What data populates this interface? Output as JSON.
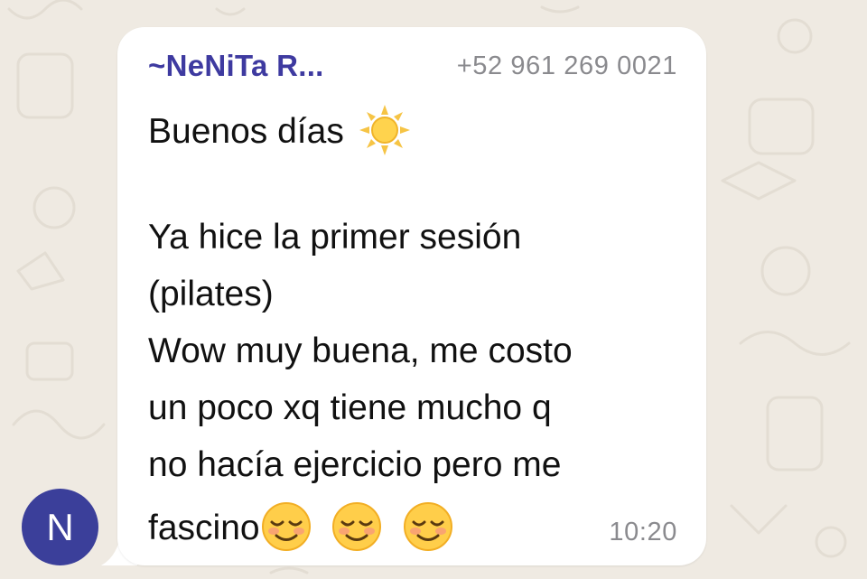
{
  "colors": {
    "background": "#efeae2",
    "bubble": "#ffffff",
    "sender_name": "#3e3aa0",
    "meta_text": "#8a8a8e",
    "avatar": "#3b3f9a"
  },
  "message": {
    "sender_prefix": "~",
    "sender_name": "NeNiTa R...",
    "sender_phone": "+52 961 269 0021",
    "lines": [
      "Buenos días",
      "Ya hice la primer sesión",
      "(pilates)",
      "Wow muy buena, me costo",
      "un poco xq tiene mucho q",
      "no hacía ejercicio pero me",
      "fascino"
    ],
    "emojis": [
      "sun-emoji",
      "smiling-face-emoji",
      "smiling-face-emoji",
      "smiling-face-emoji"
    ],
    "time": "10:20"
  },
  "avatar": {
    "initial": "N"
  }
}
